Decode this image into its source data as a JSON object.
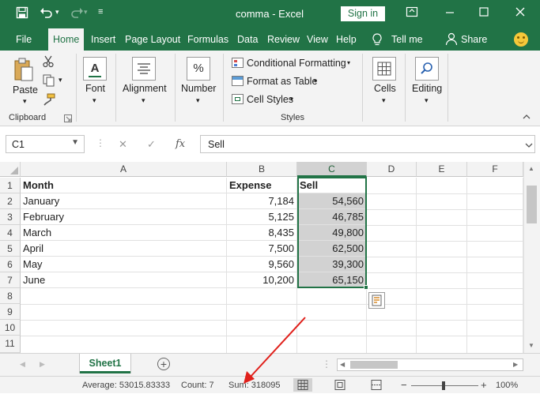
{
  "window": {
    "title": "comma  -  Excel",
    "sign_in": "Sign in"
  },
  "tabs": [
    "File",
    "Home",
    "Insert",
    "Page Layout",
    "Formulas",
    "Data",
    "Review",
    "View",
    "Help"
  ],
  "tell_me": "Tell me",
  "share": "Share",
  "ribbon": {
    "clipboard_group": "Clipboard",
    "paste": "Paste",
    "font": "Font",
    "alignment": "Alignment",
    "number": "Number",
    "conditional_formatting": "Conditional Formatting",
    "format_as_table": "Format as Table",
    "cell_styles": "Cell Styles",
    "styles_group": "Styles",
    "cells": "Cells",
    "editing": "Editing"
  },
  "formula_bar": {
    "name_box": "C1",
    "formula": "Sell"
  },
  "columns": [
    "A",
    "B",
    "C",
    "D",
    "E",
    "F"
  ],
  "rows": [
    "1",
    "2",
    "3",
    "4",
    "5",
    "6",
    "7",
    "8",
    "9",
    "10",
    "11"
  ],
  "table": {
    "headers": [
      "Month",
      "Expense",
      "Sell"
    ],
    "data": [
      [
        "January",
        "7,184",
        "54,560"
      ],
      [
        "February",
        "5,125",
        "46,785"
      ],
      [
        "March",
        "8,435",
        "49,800"
      ],
      [
        "April",
        "7,500",
        "62,500"
      ],
      [
        "May",
        "9,560",
        "39,300"
      ],
      [
        "June",
        "10,200",
        "65,150"
      ]
    ]
  },
  "sheet_tab": "Sheet1",
  "status": {
    "average": "Average: 53015.83333",
    "count": "Count: 7",
    "sum": "Sum: 318095",
    "zoom": "100%"
  },
  "colors": {
    "excel_green": "#217346",
    "annotation_arrow": "#e0201b"
  }
}
